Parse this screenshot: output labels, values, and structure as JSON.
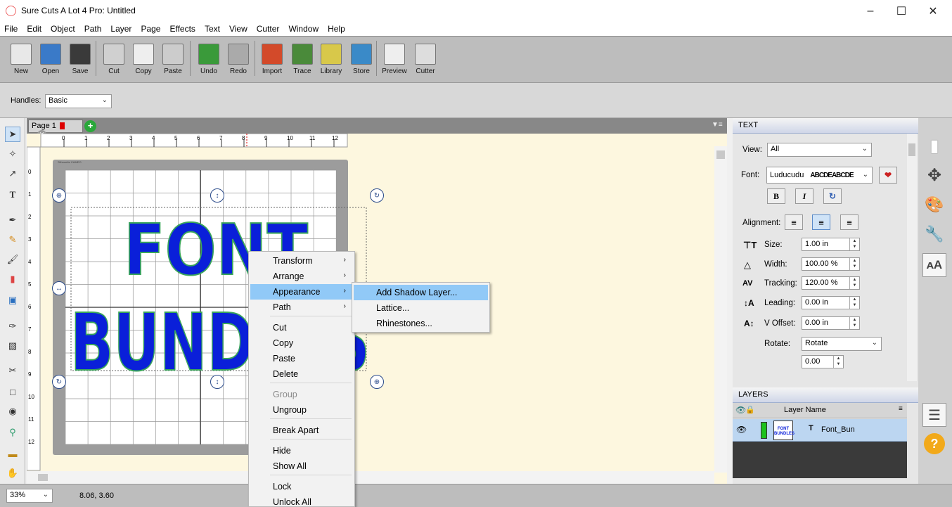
{
  "app": {
    "title": "Sure Cuts A Lot 4 Pro: Untitled"
  },
  "menubar": [
    "File",
    "Edit",
    "Object",
    "Path",
    "Layer",
    "Page",
    "Effects",
    "Text",
    "View",
    "Cutter",
    "Window",
    "Help"
  ],
  "toolbar": [
    {
      "label": "New",
      "icon": "new-document-icon"
    },
    {
      "label": "Open",
      "icon": "open-folder-icon"
    },
    {
      "label": "Save",
      "icon": "floppy-disk-icon"
    },
    {
      "label": "Cut",
      "icon": "scissors-icon"
    },
    {
      "label": "Copy",
      "icon": "copy-icon"
    },
    {
      "label": "Paste",
      "icon": "paste-icon"
    },
    {
      "label": "Undo",
      "icon": "undo-arrow-icon"
    },
    {
      "label": "Redo",
      "icon": "redo-arrow-icon"
    },
    {
      "label": "Import",
      "icon": "svg-import-icon"
    },
    {
      "label": "Trace",
      "icon": "trace-landscape-icon"
    },
    {
      "label": "Library",
      "icon": "star-library-icon"
    },
    {
      "label": "Store",
      "icon": "shopping-cart-icon"
    },
    {
      "label": "Preview",
      "icon": "magnifier-icon"
    },
    {
      "label": "Cutter",
      "icon": "blade-cutter-icon"
    }
  ],
  "handles": {
    "label": "Handles:",
    "value": "Basic"
  },
  "page_tab": {
    "label": "Page 1"
  },
  "ruler": {
    "h": [
      "0",
      "1",
      "2",
      "3",
      "4",
      "5",
      "6",
      "7",
      "8",
      "9",
      "10",
      "11",
      "12"
    ],
    "v": [
      "0",
      "1",
      "2",
      "3",
      "4",
      "5",
      "6",
      "7",
      "8",
      "9",
      "10",
      "11",
      "12"
    ]
  },
  "mat": {
    "brand": "Silhouette CAMEO"
  },
  "canvas_text": {
    "line1": "FONT",
    "line2": "BUNDLES"
  },
  "context_menu": {
    "items": [
      {
        "label": "Transform",
        "submenu": true
      },
      {
        "label": "Arrange",
        "submenu": true
      },
      {
        "label": "Appearance",
        "submenu": true,
        "highlighted": true
      },
      {
        "label": "Path",
        "submenu": true
      },
      {
        "label": "Cut"
      },
      {
        "label": "Copy"
      },
      {
        "label": "Paste"
      },
      {
        "label": "Delete"
      },
      {
        "label": "Group",
        "disabled": true
      },
      {
        "label": "Ungroup"
      },
      {
        "label": "Break Apart"
      },
      {
        "label": "Hide"
      },
      {
        "label": "Show All"
      },
      {
        "label": "Lock"
      },
      {
        "label": "Unlock All"
      }
    ],
    "submenu": [
      "Add Shadow Layer...",
      "Lattice...",
      "Rhinestones..."
    ]
  },
  "status": {
    "zoom": "33%",
    "coords": "8.06, 3.60"
  },
  "text_panel": {
    "title": "TEXT",
    "view_label": "View:",
    "view_value": "All",
    "font_label": "Font:",
    "font_value": "Luducudu",
    "font_preview": "ABCDEABCDE",
    "bold": "B",
    "italic": "I",
    "alignment_label": "Alignment:",
    "size_label": "Size:",
    "size_value": "1.00 in",
    "width_label": "Width:",
    "width_value": "100.00 %",
    "tracking_label": "Tracking:",
    "tracking_value": "120.00 %",
    "leading_label": "Leading:",
    "leading_value": "0.00 in",
    "voffset_label": "V Offset:",
    "voffset_value": "0.00 in",
    "rotate_label": "Rotate:",
    "rotate_value": "Rotate",
    "rotate_angle": "0.00"
  },
  "layers_panel": {
    "title": "LAYERS",
    "column": "Layer Name",
    "layer": {
      "name": "Font_Bun",
      "thumb": "FONT BUNDLES",
      "color": "#1ec21e"
    }
  },
  "colors": {
    "accent": "#91c9f7",
    "text_fill": "#0a1fd9",
    "text_outline": "#3aa65a"
  }
}
